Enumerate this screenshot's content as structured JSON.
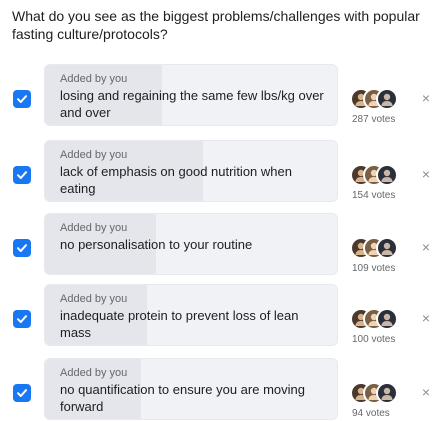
{
  "poll": {
    "question": "What do you see as the biggest problems/challenges with popular fasting culture/protocols?",
    "accent_color": "#1877f2",
    "options": [
      {
        "checked": true,
        "added_by": "Added by you",
        "text": "losing and regaining the same few lbs/kg over and over",
        "votes": "287 votes",
        "share": 0.4,
        "avatars": [
          "avatar-icon",
          "avatar-icon",
          "avatar-icon"
        ],
        "remove": "×"
      },
      {
        "checked": true,
        "added_by": "Added by you",
        "text": "lack of emphasis on good nutrition when eating",
        "votes": "154 votes",
        "share": 0.54,
        "avatars": [
          "avatar-icon",
          "avatar-icon",
          "avatar-icon"
        ],
        "remove": "×"
      },
      {
        "checked": true,
        "added_by": "Added by you",
        "text": "no personalisation to your routine",
        "votes": "109 votes",
        "share": 0.38,
        "avatars": [
          "avatar-icon",
          "avatar-icon",
          "avatar-icon"
        ],
        "remove": "×"
      },
      {
        "checked": true,
        "added_by": "Added by you",
        "text": "inadequate protein to prevent loss of lean mass",
        "votes": "100 votes",
        "share": 0.35,
        "avatars": [
          "avatar-icon",
          "avatar-icon",
          "avatar-icon"
        ],
        "remove": "×"
      },
      {
        "checked": true,
        "added_by": "Added by you",
        "text": "no quantification to ensure you are moving forward",
        "votes": "94 votes",
        "share": 0.33,
        "avatars": [
          "avatar-icon",
          "avatar-icon",
          "avatar-icon"
        ],
        "remove": "×"
      }
    ]
  }
}
